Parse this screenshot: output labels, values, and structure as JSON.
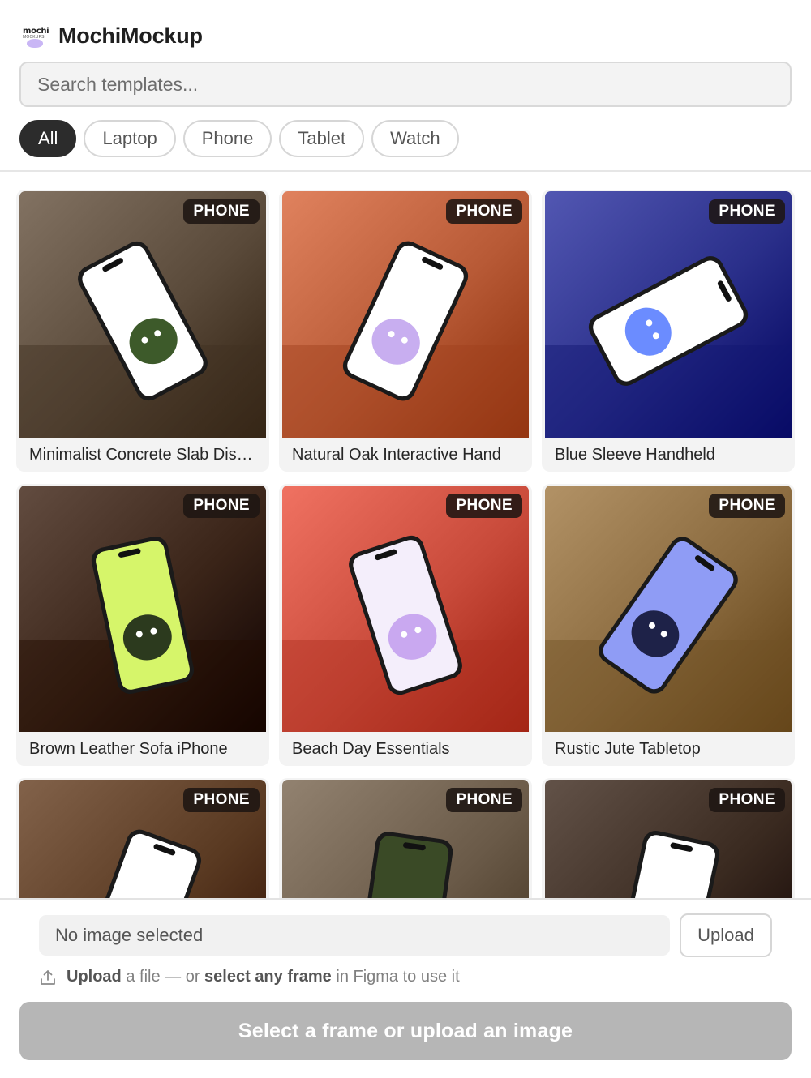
{
  "header": {
    "logo_text": "mochi",
    "logo_subtext": "MOCKUPS",
    "title": "MochiMockup"
  },
  "search": {
    "placeholder": "Search templates...",
    "value": ""
  },
  "filters": [
    {
      "label": "All",
      "active": true
    },
    {
      "label": "Laptop",
      "active": false
    },
    {
      "label": "Phone",
      "active": false
    },
    {
      "label": "Tablet",
      "active": false
    },
    {
      "label": "Watch",
      "active": false
    }
  ],
  "templates": [
    {
      "title": "Minimalist Concrete Slab Display",
      "badge": "PHONE",
      "bg": "#5a4a3a",
      "accent": "#3d5a2a",
      "screen": "#ffffff"
    },
    {
      "title": "Natural Oak Interactive Hand",
      "badge": "PHONE",
      "bg": "#b85a36",
      "accent": "#c8aef0",
      "screen": "#ffffff"
    },
    {
      "title": "Blue Sleeve Handheld",
      "badge": "PHONE",
      "bg": "#2a2f8a",
      "accent": "#6b8cff",
      "screen": "#ffffff"
    },
    {
      "title": "Brown Leather Sofa iPhone",
      "badge": "PHONE",
      "bg": "#3a2418",
      "accent": "#2c3a1e",
      "screen": "#d6f56a"
    },
    {
      "title": "Beach Day Essentials",
      "badge": "PHONE",
      "bg": "#c84a3a",
      "accent": "#c9a8f0",
      "screen": "#f4eefb"
    },
    {
      "title": "Rustic Jute Tabletop",
      "badge": "PHONE",
      "bg": "#8a6a3e",
      "accent": "#1e2248",
      "screen": "#8f9cf5"
    },
    {
      "title": "",
      "badge": "PHONE",
      "bg": "#5a3a22",
      "accent": "#8f9cf5",
      "screen": "#ffffff"
    },
    {
      "title": "",
      "badge": "PHONE",
      "bg": "#6a5a48",
      "accent": "#d6f56a",
      "screen": "#3a4a26"
    },
    {
      "title": "",
      "badge": "PHONE",
      "bg": "#3a2a20",
      "accent": "#3d5a2a",
      "screen": "#ffffff"
    }
  ],
  "footer": {
    "file_status": "No image selected",
    "upload_label": "Upload",
    "hint_upload": "Upload",
    "hint_a_file": " a file — or ",
    "hint_select": "select any frame",
    "hint_figma": " in Figma to use it",
    "cta_label": "Select a frame or upload an image"
  },
  "colors": {
    "chip_active": "#2c2c2c",
    "cta_disabled": "#b6b6b6",
    "badge_bg": "#1e1612"
  }
}
